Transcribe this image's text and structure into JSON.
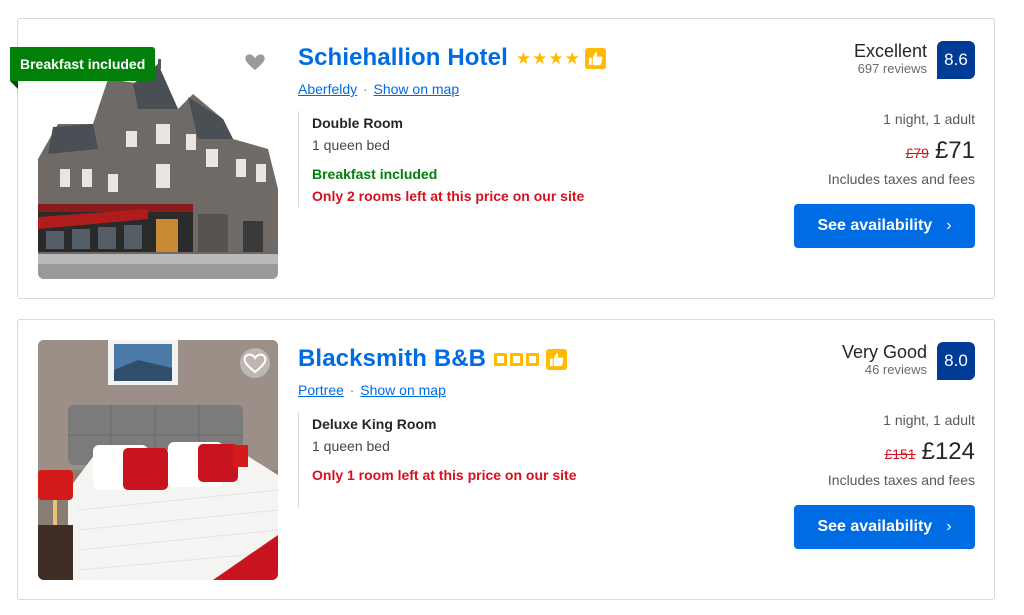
{
  "listings": [
    {
      "ribbon": "Breakfast included",
      "name": "Schiehallion Hotel",
      "rating_type": "stars",
      "rating_count": 4,
      "icon": "thumbs-up-icon",
      "location": "Aberfeldy",
      "map_link": "Show on map",
      "room_type": "Double Room",
      "bed": "1 queen bed",
      "breakfast": "Breakfast included",
      "scarcity": "Only 2 rooms left at this price on our site",
      "review_word": "Excellent",
      "review_count": "697 reviews",
      "score": "8.6",
      "stay": "1 night, 1 adult",
      "old_price": "£79",
      "price": "£71",
      "taxes": "Includes taxes and fees",
      "cta": "See availability"
    },
    {
      "ribbon": "",
      "name": "Blacksmith B&B",
      "rating_type": "squares",
      "rating_count": 3,
      "icon": "thumbs-up-icon",
      "location": "Portree",
      "map_link": "Show on map",
      "room_type": "Deluxe King Room",
      "bed": "1 queen bed",
      "breakfast": "",
      "scarcity": "Only 1 room left at this price on our site",
      "review_word": "Very Good",
      "review_count": "46 reviews",
      "score": "8.0",
      "stay": "1 night, 1 adult",
      "old_price": "£151",
      "price": "£124",
      "taxes": "Includes taxes and fees",
      "cta": "See availability"
    }
  ],
  "colors": {
    "brand_blue": "#006ce4",
    "score_blue": "#003b95",
    "green": "#008009",
    "red": "#d4111e",
    "star_yellow": "#febb02"
  }
}
